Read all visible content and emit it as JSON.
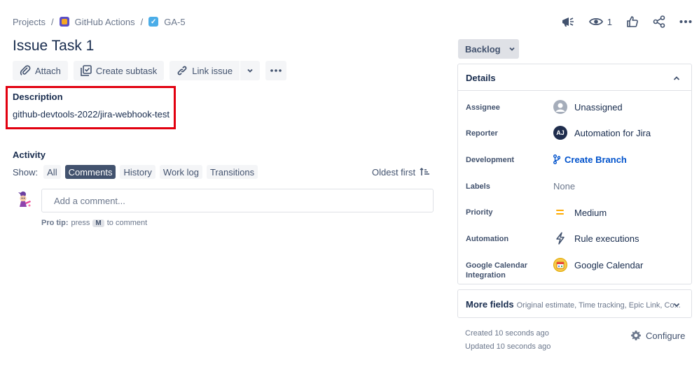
{
  "breadcrumb": {
    "projects": "Projects",
    "separator": "/",
    "project_name": "GitHub Actions",
    "issue_key": "GA-5"
  },
  "header_actions": {
    "watchers_count": "1"
  },
  "issue": {
    "title": "Issue Task 1"
  },
  "toolbar": {
    "attach": "Attach",
    "create_subtask": "Create subtask",
    "link_issue": "Link issue"
  },
  "description": {
    "label": "Description",
    "text": "github-devtools-2022/jira-webhook-test"
  },
  "activity": {
    "label": "Activity",
    "show_label": "Show:",
    "filters": [
      "All",
      "Comments",
      "History",
      "Work log",
      "Transitions"
    ],
    "active_filter": "Comments",
    "sort_label": "Oldest first",
    "comment_placeholder": "Add a comment...",
    "pro_tip_label": "Pro tip:",
    "pro_tip_pre": "press",
    "pro_tip_key": "M",
    "pro_tip_post": "to comment"
  },
  "status": {
    "label": "Backlog"
  },
  "details": {
    "heading": "Details",
    "fields": {
      "assignee": {
        "label": "Assignee",
        "value": "Unassigned"
      },
      "reporter": {
        "label": "Reporter",
        "value": "Automation for Jira",
        "initials": "AJ"
      },
      "development": {
        "label": "Development",
        "value": "Create Branch"
      },
      "labels": {
        "label": "Labels",
        "value": "None"
      },
      "priority": {
        "label": "Priority",
        "value": "Medium"
      },
      "automation": {
        "label": "Automation",
        "value": "Rule executions"
      },
      "google_calendar": {
        "label_line1": "Google Calendar",
        "label_line2": "Integration",
        "value": "Google Calendar"
      }
    }
  },
  "more_fields": {
    "label": "More fields",
    "sub": "Original estimate, Time tracking, Epic Link, Co..."
  },
  "meta": {
    "created": "Created 10 seconds ago",
    "updated": "Updated 10 seconds ago",
    "configure": "Configure"
  },
  "colors": {
    "accent": "#0052cc",
    "highlight_box": "#e2000f",
    "priority_medium": "#ffab00",
    "chip_active": "#42526e"
  }
}
